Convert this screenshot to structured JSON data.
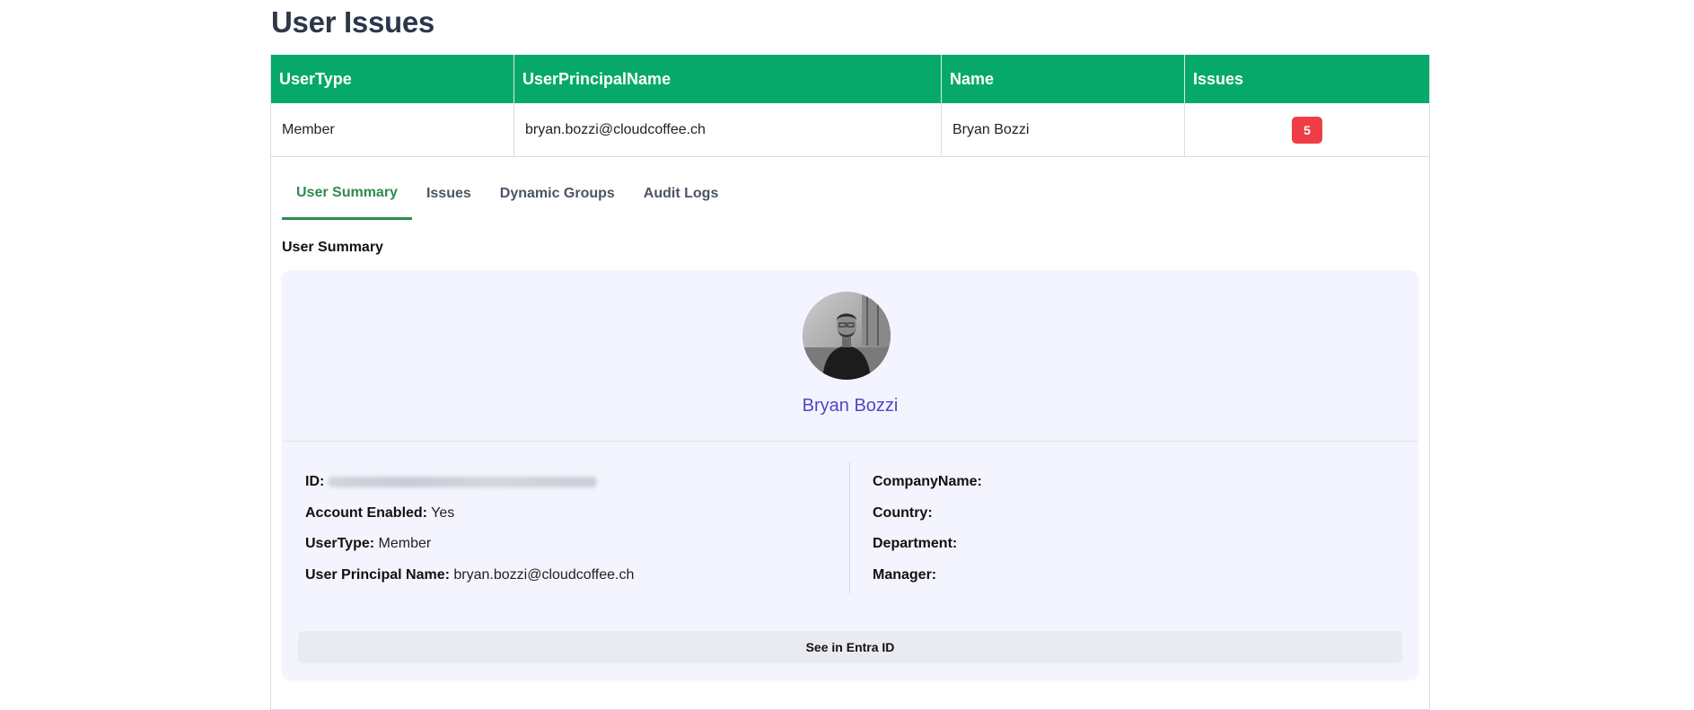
{
  "page": {
    "title": "User Issues"
  },
  "table": {
    "headers": [
      "UserType",
      "UserPrincipalName",
      "Name",
      "Issues"
    ],
    "row": {
      "user_type": "Member",
      "upn": "bryan.bozzi@cloudcoffee.ch",
      "name": "Bryan Bozzi",
      "issues": "5"
    }
  },
  "tabs": [
    {
      "label": "User Summary",
      "active": true
    },
    {
      "label": "Issues",
      "active": false
    },
    {
      "label": "Dynamic Groups",
      "active": false
    },
    {
      "label": "Audit Logs",
      "active": false
    }
  ],
  "summary": {
    "section_title": "User Summary",
    "display_name": "Bryan Bozzi",
    "left_fields": [
      {
        "label": "ID:",
        "value": ""
      },
      {
        "label": "Account Enabled:",
        "value": "Yes"
      },
      {
        "label": "UserType:",
        "value": "Member"
      },
      {
        "label": "User Principal Name:",
        "value": "bryan.bozzi@cloudcoffee.ch"
      }
    ],
    "right_fields": [
      {
        "label": "CompanyName:",
        "value": ""
      },
      {
        "label": "Country:",
        "value": ""
      },
      {
        "label": "Department:",
        "value": ""
      },
      {
        "label": "Manager:",
        "value": ""
      }
    ],
    "button_label": "See in Entra ID"
  },
  "colors": {
    "header_green": "#07a96b",
    "badge_red": "#ef3d47",
    "active_tab": "#2f8a4f",
    "name_purple": "#4f46c8",
    "card_bg": "#f3f4fd"
  }
}
